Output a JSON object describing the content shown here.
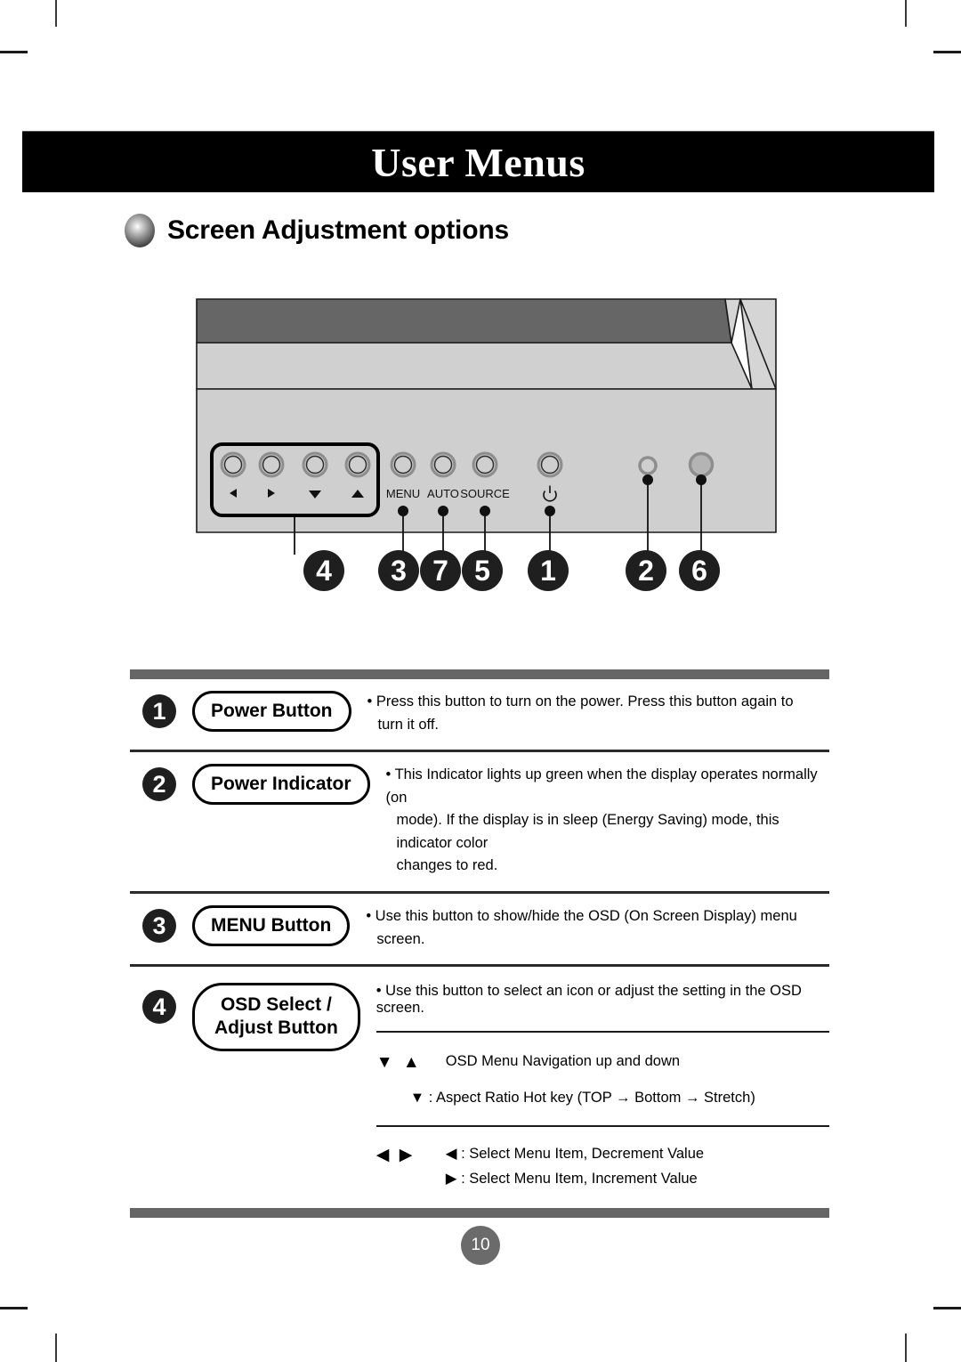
{
  "banner": {
    "title": "User Menus"
  },
  "section": {
    "title": "Screen Adjustment options",
    "bullet_icon": "sphere-bullet-icon"
  },
  "monitor": {
    "panel_labels": [
      "MENU",
      "AUTO",
      "SOURCE"
    ],
    "power_glyph": "⏻",
    "arrow_glyphs": [
      "◀",
      "▶",
      "▼",
      "▲"
    ],
    "callouts": [
      "4",
      "3",
      "7",
      "5",
      "1",
      "2",
      "6"
    ],
    "colors": {
      "screen": "#666666",
      "bezel": "#cfcfcf",
      "bezel_dark": "#c2c2c2",
      "outline": "#1a1a1a"
    }
  },
  "table": {
    "rows": [
      {
        "number": "1",
        "label": "Power Button",
        "lines": [
          "• Press this button to turn on the power. Press this button again to",
          "turn it off."
        ]
      },
      {
        "number": "2",
        "label": "Power Indicator",
        "lines": [
          "• This Indicator lights up green when the display operates normally (on",
          "mode). If the display is in sleep (Energy Saving) mode, this indicator color",
          "changes to red."
        ]
      },
      {
        "number": "3",
        "label": "MENU Button",
        "lines": [
          "• Use this button to show/hide the OSD (On Screen Display) menu",
          "screen."
        ]
      },
      {
        "number": "4",
        "label_line1": "OSD Select /",
        "label_line2": "Adjust Button",
        "main_line": "•  Use this button to select an icon or adjust the setting in the OSD screen.",
        "sub_rows": [
          {
            "glyph": "▼ ▲",
            "lines": [
              "OSD Menu Navigation up and down",
              "▼ : Aspect Ratio Hot key (TOP → Bottom → Stretch)"
            ]
          },
          {
            "glyph": "◀ ▶",
            "lines": [
              "◀ : Select Menu Item, Decrement Value",
              "▶ : Select Menu Item, Increment Value"
            ]
          }
        ]
      }
    ]
  },
  "footer": {
    "page_number": "10"
  }
}
